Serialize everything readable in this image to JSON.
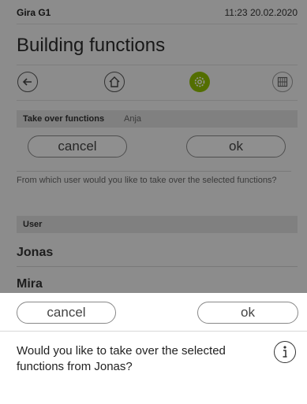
{
  "status_bar": {
    "app_name": "Gira G1",
    "datetime": "11:23 20.02.2020"
  },
  "page": {
    "title": "Building functions"
  },
  "nav": {
    "icons": [
      "back-arrow-icon",
      "home-icon",
      "gear-icon",
      "grid-icon"
    ],
    "active": "gear-icon",
    "active_color": "#8fbe00"
  },
  "take_over": {
    "label": "Take over functions",
    "name": "Anja",
    "cancel_label": "cancel",
    "ok_label": "ok",
    "question": "From which user would you like to take over the selected functions?"
  },
  "user_list": {
    "header": "User",
    "users": [
      "Jonas",
      "Mira"
    ]
  },
  "dialog": {
    "cancel_label": "cancel",
    "ok_label": "ok",
    "message": "Would you like to take over the selected functions from Jonas?",
    "info_icon": "info-icon"
  }
}
